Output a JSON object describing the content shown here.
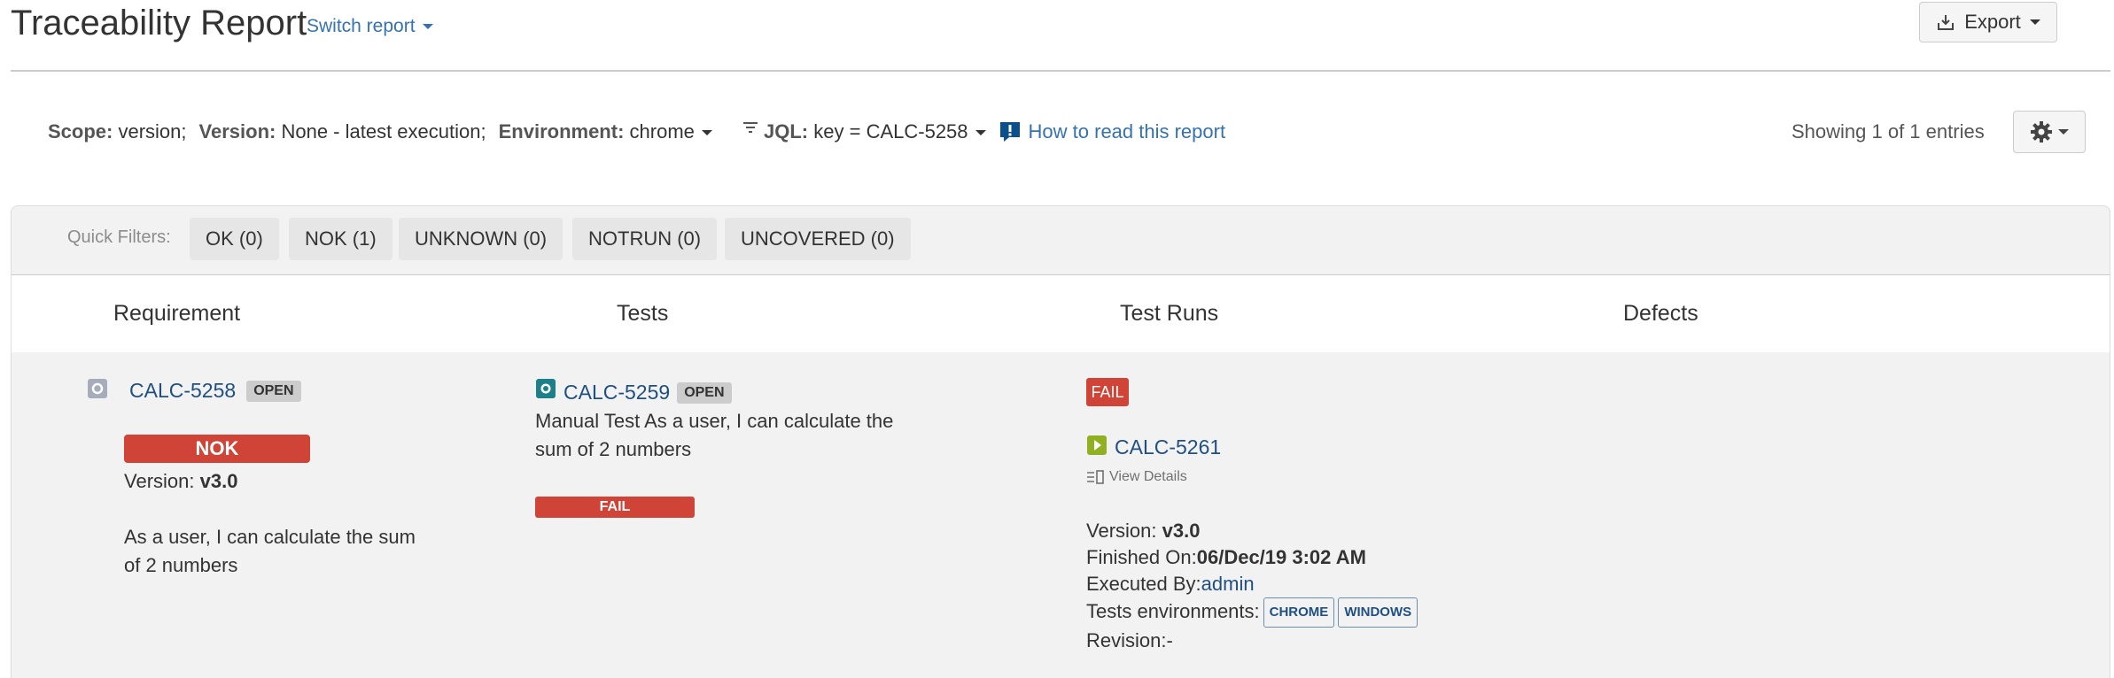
{
  "header": {
    "title": "Traceability Report",
    "switch_report": "Switch report",
    "export_label": "Export"
  },
  "filters": {
    "scope_label": "Scope:",
    "scope_value": "version;",
    "version_label": "Version:",
    "version_value": "None - latest execution;",
    "environment_label": "Environment:",
    "environment_value": "chrome",
    "jql_label": "JQL:",
    "jql_value": "key = CALC-5258",
    "help_link": "How to read this report",
    "showing": "Showing 1 of 1 entries"
  },
  "quick_filters": {
    "label": "Quick Filters:",
    "items": [
      "OK (0)",
      "NOK (1)",
      "UNKNOWN (0)",
      "NOTRUN (0)",
      "UNCOVERED (0)"
    ]
  },
  "columns": [
    "Requirement",
    "Tests",
    "Test Runs",
    "Defects"
  ],
  "row": {
    "requirement": {
      "key": "CALC-5258",
      "status": "OPEN",
      "coverage": "NOK",
      "version_label": "Version:",
      "version_value": "v3.0",
      "summary_line1": "As a user, I can calculate the sum",
      "summary_line2": "of 2 numbers"
    },
    "test": {
      "key": "CALC-5259",
      "status": "OPEN",
      "summary_line1": "Manual Test As a user, I can calculate the",
      "summary_line2": "sum of 2 numbers",
      "result": "FAIL"
    },
    "test_run": {
      "status": "FAIL",
      "key": "CALC-5261",
      "view_details": "View Details",
      "version_label": "Version:",
      "version_value": "v3.0",
      "finished_label": "Finished On:",
      "finished_value": "06/Dec/19 3:02 AM",
      "executed_label": "Executed By:",
      "executed_value": "admin",
      "envs_label": "Tests environments:",
      "envs": [
        "CHROME",
        "WINDOWS"
      ],
      "revision": "Revision:-"
    }
  },
  "colors": {
    "fail": "#d04437",
    "link": "#205081",
    "test_icon": "#1c7f8a",
    "run_icon": "#8eb021"
  }
}
